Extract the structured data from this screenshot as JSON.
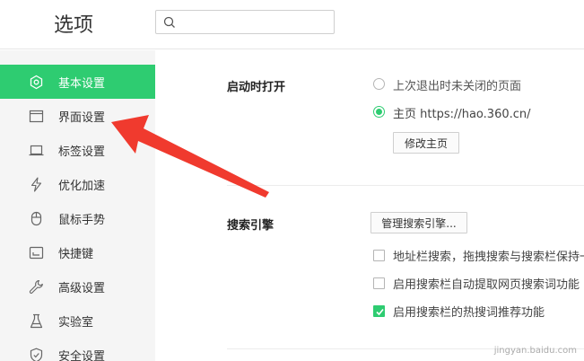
{
  "header": {
    "title": "选项",
    "search_placeholder": ""
  },
  "sidebar": {
    "items": [
      {
        "label": "基本设置",
        "icon": "settings-hexagon-icon",
        "active": true
      },
      {
        "label": "界面设置",
        "icon": "window-icon",
        "active": false
      },
      {
        "label": "标签设置",
        "icon": "tab-icon",
        "active": false
      },
      {
        "label": "优化加速",
        "icon": "lightning-icon",
        "active": false
      },
      {
        "label": "鼠标手势",
        "icon": "mouse-icon",
        "active": false
      },
      {
        "label": "快捷键",
        "icon": "keyboard-shortcut-icon",
        "active": false
      },
      {
        "label": "高级设置",
        "icon": "wrench-icon",
        "active": false
      },
      {
        "label": "实验室",
        "icon": "flask-icon",
        "active": false
      },
      {
        "label": "安全设置",
        "icon": "shield-icon",
        "active": false
      }
    ]
  },
  "startup": {
    "title": "启动时打开",
    "option_last": "上次退出时未关闭的页面",
    "option_home": "主页  https://hao.360.cn/",
    "selected": "home",
    "modify_button": "修改主页"
  },
  "search_engine": {
    "title": "搜索引擎",
    "manage_button": "管理搜索引擎...",
    "options": [
      {
        "label": "地址栏搜索，拖拽搜索与搜索栏保持一",
        "checked": false
      },
      {
        "label": "启用搜索栏自动提取网页搜索词功能",
        "checked": false
      },
      {
        "label": "启用搜索栏的热搜词推荐功能",
        "checked": true
      }
    ]
  },
  "colors": {
    "accent": "#2ecc71",
    "annotation_arrow": "#f03a2e"
  },
  "watermark": "jingyan.baidu.com"
}
